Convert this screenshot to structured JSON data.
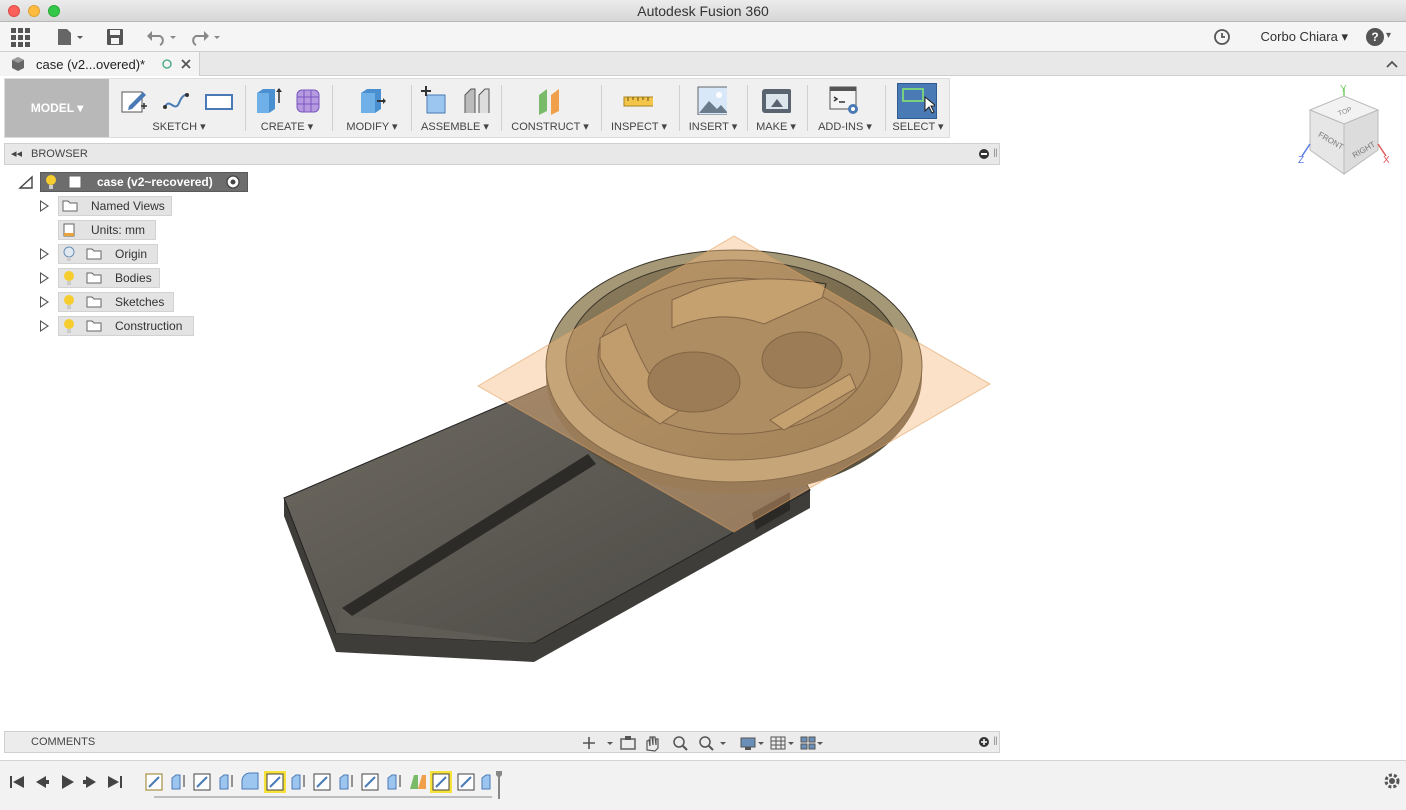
{
  "window": {
    "title": "Autodesk Fusion 360"
  },
  "quickbar": {
    "user": "Corbo Chiara",
    "help": "?"
  },
  "doc_tab": {
    "name": "case (v2...overed)*"
  },
  "toolbar": {
    "workspace": "MODEL",
    "groups": [
      {
        "label": "SKETCH"
      },
      {
        "label": "CREATE"
      },
      {
        "label": "MODIFY"
      },
      {
        "label": "ASSEMBLE"
      },
      {
        "label": "CONSTRUCT"
      },
      {
        "label": "INSPECT"
      },
      {
        "label": "INSERT"
      },
      {
        "label": "MAKE"
      },
      {
        "label": "ADD-INS"
      },
      {
        "label": "SELECT"
      }
    ]
  },
  "browser": {
    "title": "BROWSER",
    "root": "case (v2~recovered)",
    "items": [
      {
        "label": "Named Views"
      },
      {
        "label": "Units: mm"
      },
      {
        "label": "Origin"
      },
      {
        "label": "Bodies"
      },
      {
        "label": "Sketches"
      },
      {
        "label": "Construction"
      }
    ]
  },
  "viewcube": {
    "top": "TOP",
    "front": "FRONT",
    "right": "RIGHT",
    "axis_x": "X",
    "axis_y": "Y",
    "axis_z": "Z"
  },
  "comments": {
    "title": "COMMENTS"
  },
  "colors": {
    "accent": "#4a7ab5",
    "plane": "#f5b87a",
    "model": "#6b6455"
  }
}
